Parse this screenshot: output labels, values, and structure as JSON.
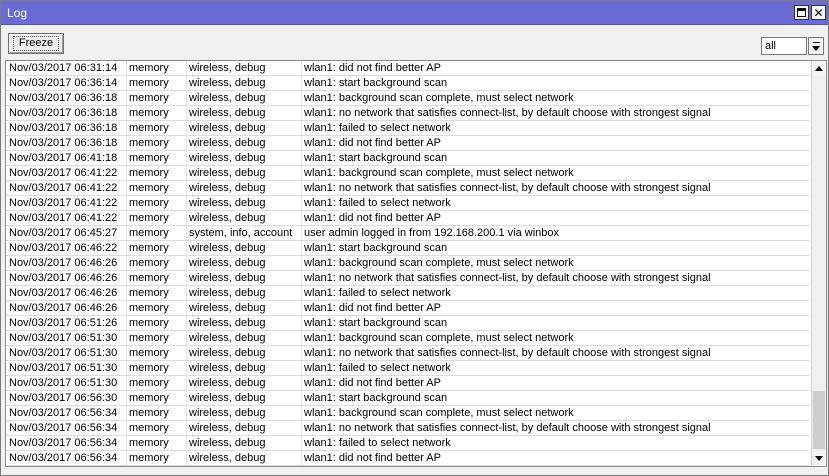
{
  "window": {
    "title": "Log"
  },
  "toolbar": {
    "freeze_label": "Freeze",
    "filter_value": "all"
  },
  "icons": {
    "maximize": "maximize-icon",
    "close": "close-icon",
    "dropdown": "chevron-down-icon",
    "scroll_up": "arrow-up-icon",
    "scroll_down": "arrow-down-icon"
  },
  "colors": {
    "titlebar": "#6b6bd6",
    "title_text": "#ffffff",
    "row_border": "#dcdcdc"
  },
  "log": {
    "rows": [
      {
        "time": "Nov/03/2017 06:31:14",
        "buffer": "memory",
        "topics": "wireless, debug",
        "message": "wlan1: did not find better AP"
      },
      {
        "time": "Nov/03/2017 06:36:14",
        "buffer": "memory",
        "topics": "wireless, debug",
        "message": "wlan1: start background scan"
      },
      {
        "time": "Nov/03/2017 06:36:18",
        "buffer": "memory",
        "topics": "wireless, debug",
        "message": "wlan1: background scan complete, must select network"
      },
      {
        "time": "Nov/03/2017 06:36:18",
        "buffer": "memory",
        "topics": "wireless, debug",
        "message": "wlan1: no network that satisfies connect-list,  by default choose with strongest signal"
      },
      {
        "time": "Nov/03/2017 06:36:18",
        "buffer": "memory",
        "topics": "wireless, debug",
        "message": "wlan1: failed to select network"
      },
      {
        "time": "Nov/03/2017 06:36:18",
        "buffer": "memory",
        "topics": "wireless, debug",
        "message": "wlan1: did not find better AP"
      },
      {
        "time": "Nov/03/2017 06:41:18",
        "buffer": "memory",
        "topics": "wireless, debug",
        "message": "wlan1: start background scan"
      },
      {
        "time": "Nov/03/2017 06:41:22",
        "buffer": "memory",
        "topics": "wireless, debug",
        "message": "wlan1: background scan complete, must select network"
      },
      {
        "time": "Nov/03/2017 06:41:22",
        "buffer": "memory",
        "topics": "wireless, debug",
        "message": "wlan1: no network that satisfies connect-list,  by default choose with strongest signal"
      },
      {
        "time": "Nov/03/2017 06:41:22",
        "buffer": "memory",
        "topics": "wireless, debug",
        "message": "wlan1: failed to select network"
      },
      {
        "time": "Nov/03/2017 06:41:22",
        "buffer": "memory",
        "topics": "wireless, debug",
        "message": "wlan1: did not find better AP"
      },
      {
        "time": "Nov/03/2017 06:45:27",
        "buffer": "memory",
        "topics": "system, info, account",
        "message": "user admin logged in from 192.168.200.1 via winbox"
      },
      {
        "time": "Nov/03/2017 06:46:22",
        "buffer": "memory",
        "topics": "wireless, debug",
        "message": "wlan1: start background scan"
      },
      {
        "time": "Nov/03/2017 06:46:26",
        "buffer": "memory",
        "topics": "wireless, debug",
        "message": "wlan1: background scan complete, must select network"
      },
      {
        "time": "Nov/03/2017 06:46:26",
        "buffer": "memory",
        "topics": "wireless, debug",
        "message": "wlan1: no network that satisfies connect-list,  by default choose with strongest signal"
      },
      {
        "time": "Nov/03/2017 06:46:26",
        "buffer": "memory",
        "topics": "wireless, debug",
        "message": "wlan1: failed to select network"
      },
      {
        "time": "Nov/03/2017 06:46:26",
        "buffer": "memory",
        "topics": "wireless, debug",
        "message": "wlan1: did not find better AP"
      },
      {
        "time": "Nov/03/2017 06:51:26",
        "buffer": "memory",
        "topics": "wireless, debug",
        "message": "wlan1: start background scan"
      },
      {
        "time": "Nov/03/2017 06:51:30",
        "buffer": "memory",
        "topics": "wireless, debug",
        "message": "wlan1: background scan complete, must select network"
      },
      {
        "time": "Nov/03/2017 06:51:30",
        "buffer": "memory",
        "topics": "wireless, debug",
        "message": "wlan1: no network that satisfies connect-list,  by default choose with strongest signal"
      },
      {
        "time": "Nov/03/2017 06:51:30",
        "buffer": "memory",
        "topics": "wireless, debug",
        "message": "wlan1: failed to select network"
      },
      {
        "time": "Nov/03/2017 06:51:30",
        "buffer": "memory",
        "topics": "wireless, debug",
        "message": "wlan1: did not find better AP"
      },
      {
        "time": "Nov/03/2017 06:56:30",
        "buffer": "memory",
        "topics": "wireless, debug",
        "message": "wlan1: start background scan"
      },
      {
        "time": "Nov/03/2017 06:56:34",
        "buffer": "memory",
        "topics": "wireless, debug",
        "message": "wlan1: background scan complete, must select network"
      },
      {
        "time": "Nov/03/2017 06:56:34",
        "buffer": "memory",
        "topics": "wireless, debug",
        "message": "wlan1: no network that satisfies connect-list,  by default choose with strongest signal"
      },
      {
        "time": "Nov/03/2017 06:56:34",
        "buffer": "memory",
        "topics": "wireless, debug",
        "message": "wlan1: failed to select network"
      },
      {
        "time": "Nov/03/2017 06:56:34",
        "buffer": "memory",
        "topics": "wireless, debug",
        "message": "wlan1: did not find better AP"
      }
    ]
  }
}
